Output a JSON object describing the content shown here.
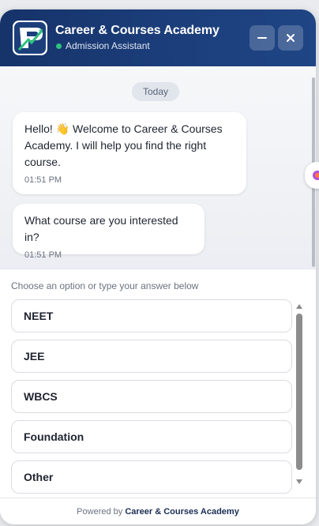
{
  "header": {
    "title": "Career & Courses Academy",
    "subtitle": "Admission Assistant",
    "minimize_icon": "minus-icon",
    "close_icon": "close-icon",
    "logo_icon": "academy-logo"
  },
  "chat": {
    "date_label": "Today",
    "messages": [
      {
        "text": "Hello! 👋 Welcome to Career & Courses Academy. I will help you find the right course.",
        "time": "01:51 PM"
      },
      {
        "text": "What course are you interested in?",
        "time": "01:51 PM"
      }
    ]
  },
  "options": {
    "hint": "Choose an option or type your answer below",
    "items": [
      "NEET",
      "JEE",
      "WBCS",
      "Foundation",
      "Other"
    ]
  },
  "footer": {
    "powered_by": "Powered by",
    "brand": "Career & Courses Academy"
  },
  "colors": {
    "header": "#1c3f7c",
    "status_dot": "#2ec27e",
    "chat_bg": "#f3f4f7"
  }
}
